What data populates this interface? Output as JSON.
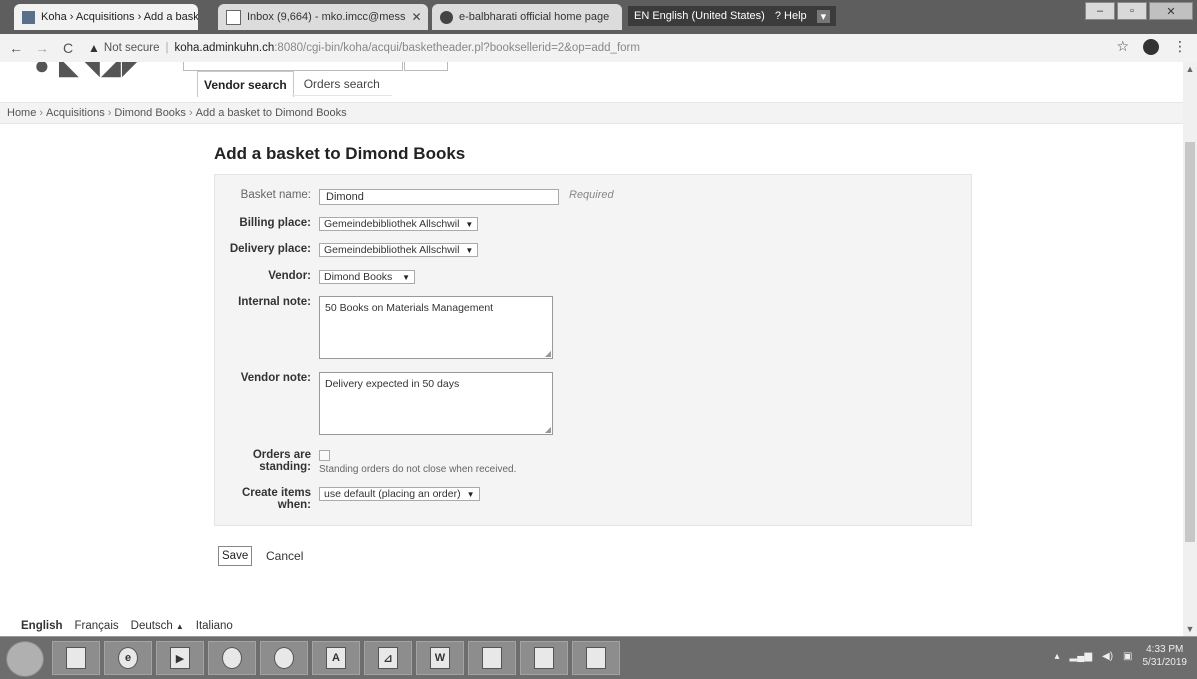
{
  "browser": {
    "tabs": [
      {
        "title": "Koha › Acquisitions › Add a bask",
        "active": true
      },
      {
        "title": "Inbox (9,664) - mko.imcc@mess",
        "active": false
      },
      {
        "title": "e-balbharati official home page",
        "active": false
      }
    ],
    "lang_bar": {
      "lang": "EN English (United States)",
      "help": "Help"
    },
    "address": {
      "security": "Not secure",
      "host": "koha.adminkuhn.ch",
      "path": ":8080/cgi-bin/koha/acqui/basketheader.pl?booksellerid=2&op=add_form"
    }
  },
  "search_tabs": {
    "vendor_search": "Vendor search",
    "orders_search": "Orders search"
  },
  "breadcrumb": {
    "home": "Home",
    "acquisitions": "Acquisitions",
    "vendor": "Dimond Books",
    "current": "Add a basket to Dimond Books",
    "sep": "›"
  },
  "page_title": "Add a basket to Dimond Books",
  "form": {
    "basket_name": {
      "label": "Basket name:",
      "value": "Dimond",
      "required": "Required"
    },
    "billing_place": {
      "label": "Billing place:",
      "value": "Gemeindebibliothek Allschwil"
    },
    "delivery_place": {
      "label": "Delivery place:",
      "value": "Gemeindebibliothek Allschwil"
    },
    "vendor": {
      "label": "Vendor:",
      "value": "Dimond Books"
    },
    "internal_note": {
      "label": "Internal note:",
      "value": "50 Books on Materials Management"
    },
    "vendor_note": {
      "label": "Vendor note:",
      "value": "Delivery expected in 50 days"
    },
    "orders_standing": {
      "label": "Orders are standing:",
      "hint": "Standing orders do not close when received."
    },
    "create_items": {
      "label": "Create items when:",
      "value": "use default (placing an order)"
    }
  },
  "actions": {
    "save": "Save",
    "cancel": "Cancel"
  },
  "footer_languages": [
    {
      "label": "English",
      "current": true
    },
    {
      "label": "Français",
      "current": false
    },
    {
      "label": "Deutsch",
      "current": false,
      "dropdown": true
    },
    {
      "label": "Italiano",
      "current": false
    }
  ],
  "taskbar": {
    "time": "4:33 PM",
    "date": "5/31/2019"
  }
}
